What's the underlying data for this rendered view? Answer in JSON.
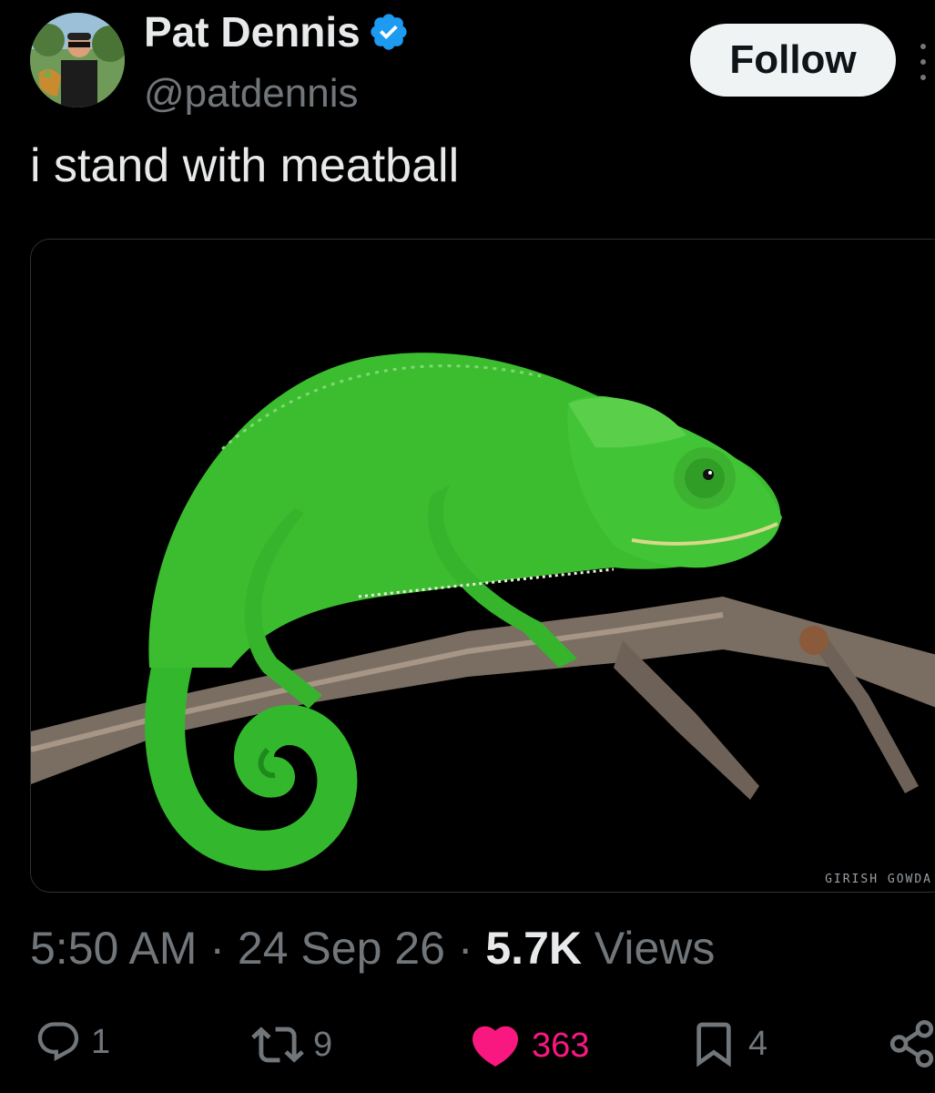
{
  "user": {
    "name": "Pat Dennis",
    "handle": "@patdennis",
    "verified": true
  },
  "follow_label": "Follow",
  "tweet_text": "i stand with meatball",
  "media": {
    "watermark": "GIRISH GOWDA",
    "icon": "chameleon-photo"
  },
  "meta": {
    "time": "5:50 AM",
    "separator": "·",
    "date": "24 Sep 26",
    "views_count": "5.7K",
    "views_label": "Views"
  },
  "actions": {
    "replies": "1",
    "reposts": "9",
    "likes": "363",
    "bookmarks": "4"
  },
  "colors": {
    "background": "#000000",
    "text": "#e7e9ea",
    "secondary": "#71767b",
    "like": "#f91880",
    "verified": "#1d9bf0",
    "follow_bg": "#eff3f4"
  }
}
